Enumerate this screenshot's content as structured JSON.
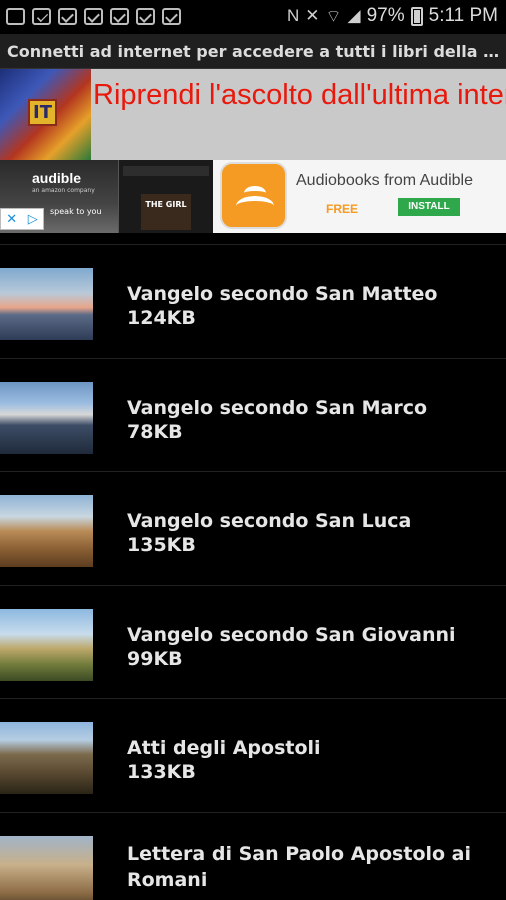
{
  "status_bar": {
    "battery": "97%",
    "time": "5:11 PM"
  },
  "notice": {
    "text": "Connetti ad internet per accedere a tutti i libri della Bi..."
  },
  "ad": {
    "headline": "Riprendi l'ascolto dall'ultima interruzione",
    "badge": "IT",
    "banner_brand": "audible",
    "banner_sub": "an amazon company",
    "banner_tagline": "speak to you",
    "cover_text": "THE GIRL",
    "app_title": "Audiobooks from Audible",
    "free_label": "FREE",
    "install_label": "INSTALL"
  },
  "books": [
    {
      "title": "Vangelo secondo San Matteo",
      "size": "124KB",
      "thumb": "t1"
    },
    {
      "title": "Vangelo secondo San Marco",
      "size": "78KB",
      "thumb": "t2"
    },
    {
      "title": "Vangelo secondo San Luca",
      "size": "135KB",
      "thumb": "t3"
    },
    {
      "title": "Vangelo secondo San Giovanni",
      "size": "99KB",
      "thumb": "t4"
    },
    {
      "title": "Atti degli Apostoli",
      "size": "133KB",
      "thumb": "t5"
    },
    {
      "title": "Lettera di San Paolo Apostolo ai Romani",
      "size": "",
      "thumb": "t6"
    }
  ]
}
